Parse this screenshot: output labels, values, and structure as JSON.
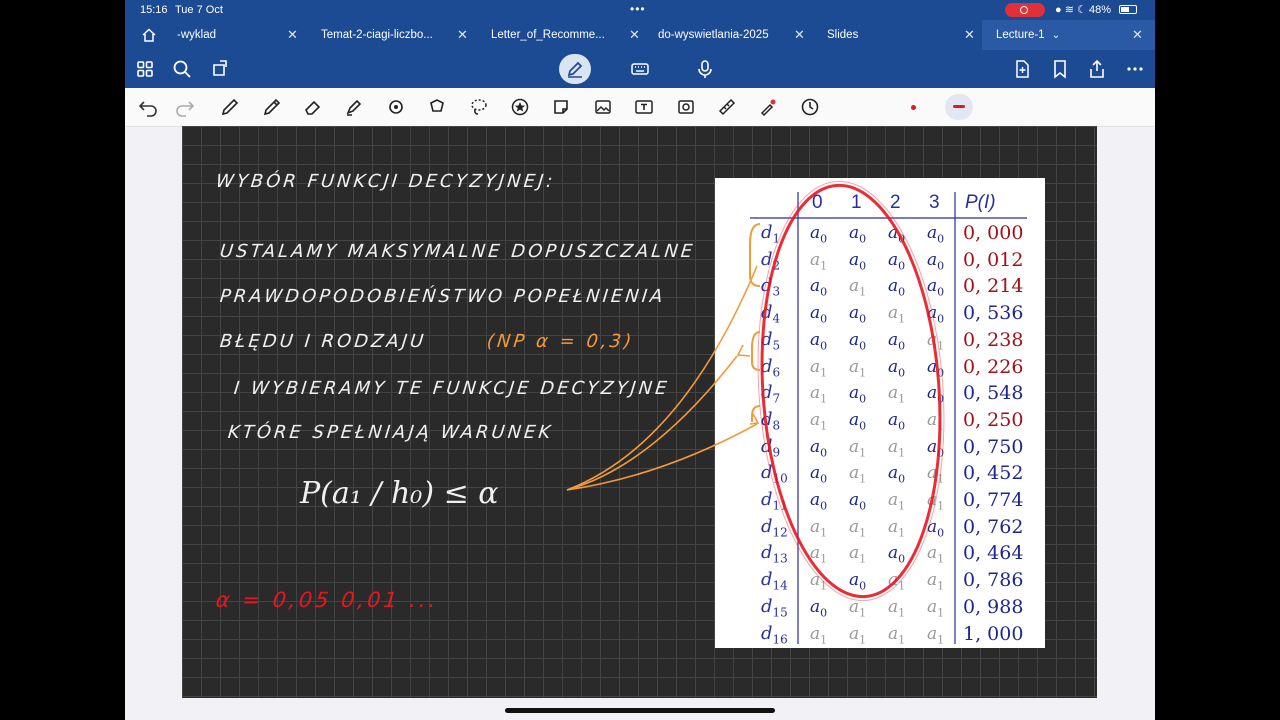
{
  "status": {
    "time": "15:16",
    "date": "Tue 7 Oct",
    "battery": "48%"
  },
  "tabs": [
    {
      "label": "-wyklad",
      "active": false
    },
    {
      "label": "Temat-2-ciagi-liczbo...",
      "active": false
    },
    {
      "label": "Letter_of_Recomme...",
      "active": false
    },
    {
      "label": "do-wyswietlania-2025",
      "active": false
    },
    {
      "label": "Slides",
      "active": false
    },
    {
      "label": "Lecture-1",
      "active": true
    }
  ],
  "note": {
    "heading": "WYBÓR FUNKCJI DECYZYJNEJ:",
    "lines": [
      "USTALAMY MAKSYMALNE DOPUSZCZALNE",
      "PRAWDOPODOBIEŃSTWO POPEŁNIENIA",
      "BŁĘDU I RODZAJU",
      "I WYBIERAMY TE FUNKCJE DECYZYJNE",
      "KTÓRE SPEŁNIAJĄ WARUNEK"
    ],
    "example": "(NP α = 0,3)",
    "formula": "P(a₁ / h₀) ≤ α",
    "alpha_values": "α = 0,05    0,01 ..."
  },
  "table": {
    "headers": [
      "0",
      "1",
      "2",
      "3",
      "P(I)"
    ],
    "rows": [
      {
        "d": "d",
        "sub": "1",
        "cells": [
          "0",
          "0",
          "0",
          "0"
        ],
        "p": "0, 000",
        "red": true
      },
      {
        "d": "d",
        "sub": "2",
        "cells": [
          "1",
          "0",
          "0",
          "0"
        ],
        "p": "0, 012",
        "red": true
      },
      {
        "d": "d",
        "sub": "3",
        "cells": [
          "0",
          "1",
          "0",
          "0"
        ],
        "p": "0, 214",
        "red": true
      },
      {
        "d": "d",
        "sub": "4",
        "cells": [
          "0",
          "0",
          "1",
          "0"
        ],
        "p": "0, 536",
        "red": false
      },
      {
        "d": "d",
        "sub": "5",
        "cells": [
          "0",
          "0",
          "0",
          "1"
        ],
        "p": "0, 238",
        "red": true
      },
      {
        "d": "d",
        "sub": "6",
        "cells": [
          "1",
          "1",
          "0",
          "0"
        ],
        "p": "0, 226",
        "red": true
      },
      {
        "d": "d",
        "sub": "7",
        "cells": [
          "1",
          "0",
          "1",
          "0"
        ],
        "p": "0, 548",
        "red": false
      },
      {
        "d": "d",
        "sub": "8",
        "cells": [
          "1",
          "0",
          "0",
          "1"
        ],
        "p": "0, 250",
        "red": true
      },
      {
        "d": "d",
        "sub": "9",
        "cells": [
          "0",
          "1",
          "1",
          "0"
        ],
        "p": "0, 750",
        "red": false
      },
      {
        "d": "d",
        "sub": "10",
        "cells": [
          "0",
          "1",
          "0",
          "1"
        ],
        "p": "0, 452",
        "red": false
      },
      {
        "d": "d",
        "sub": "11",
        "cells": [
          "0",
          "0",
          "1",
          "1"
        ],
        "p": "0, 774",
        "red": false
      },
      {
        "d": "d",
        "sub": "12",
        "cells": [
          "1",
          "1",
          "1",
          "0"
        ],
        "p": "0, 762",
        "red": false
      },
      {
        "d": "d",
        "sub": "13",
        "cells": [
          "1",
          "1",
          "0",
          "1"
        ],
        "p": "0, 464",
        "red": false
      },
      {
        "d": "d",
        "sub": "14",
        "cells": [
          "1",
          "0",
          "1",
          "1"
        ],
        "p": "0, 786",
        "red": false
      },
      {
        "d": "d",
        "sub": "15",
        "cells": [
          "0",
          "1",
          "1",
          "1"
        ],
        "p": "0, 988",
        "red": false
      },
      {
        "d": "d",
        "sub": "16",
        "cells": [
          "1",
          "1",
          "1",
          "1"
        ],
        "p": "1, 000",
        "red": false
      }
    ]
  }
}
